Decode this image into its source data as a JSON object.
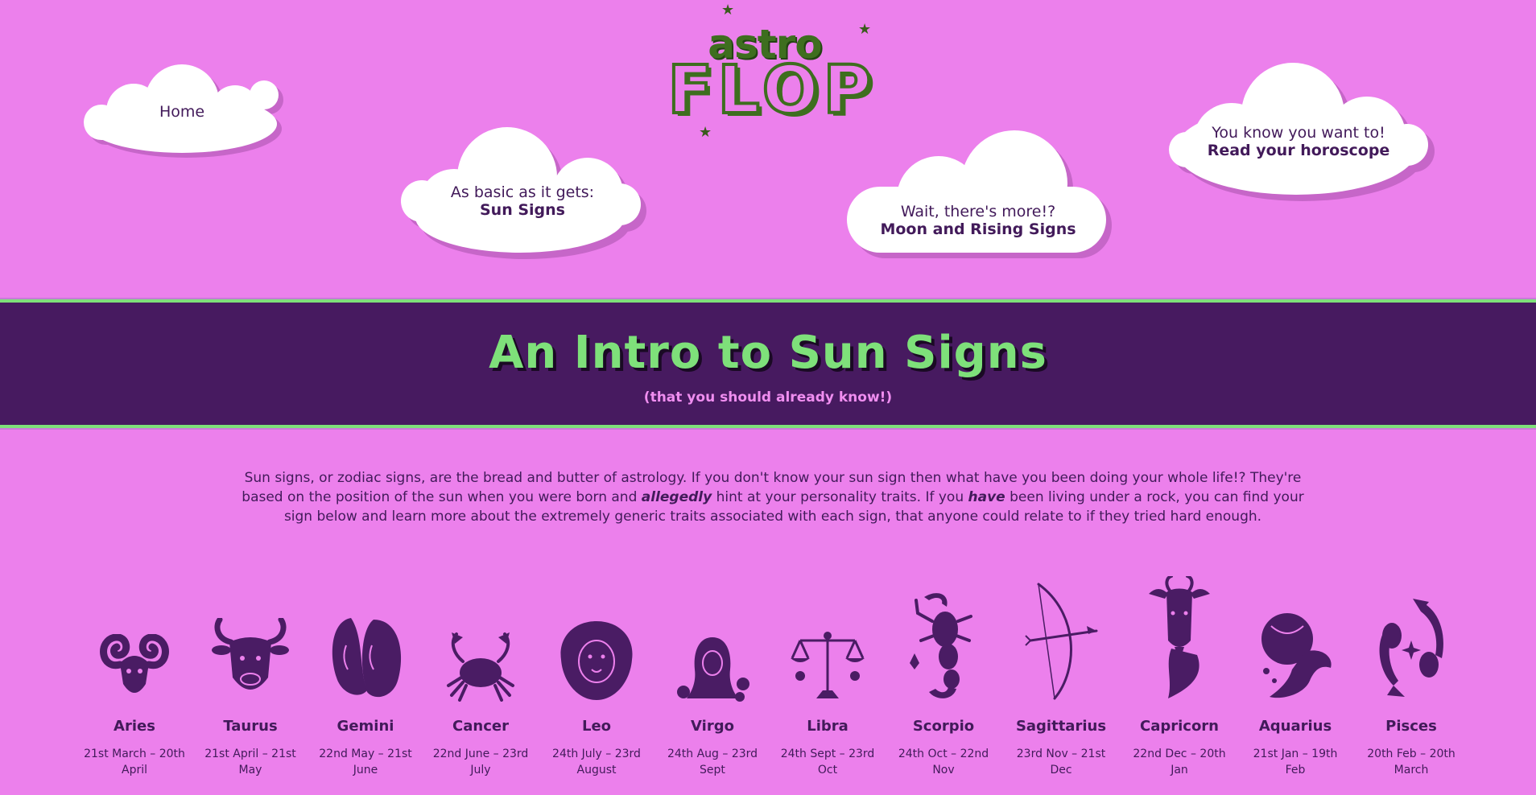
{
  "logo": {
    "top_text": "astro",
    "bottom_text": "FLOP"
  },
  "nav": {
    "home": {
      "line1": "Home"
    },
    "sun": {
      "line1": "As basic as it gets:",
      "line2": "Sun Signs"
    },
    "moon": {
      "line1": "Wait, there's more!?",
      "line2": "Moon and Rising Signs"
    },
    "horoscope": {
      "line1": "You know you want to!",
      "line2": "Read your horoscope"
    }
  },
  "banner": {
    "title": "An Intro to Sun Signs",
    "subtitle": "(that you should already know!)"
  },
  "intro": {
    "part1": "Sun signs, or zodiac signs, are the bread and butter of astrology. If you don't know your sun sign then what have you been doing your whole life!? They're based on the position of the sun when you were born and ",
    "emph1": "allegedly",
    "part2": " hint at your personality traits. If you ",
    "emph2": "have",
    "part3": " been living under a rock, you can find your sign below and learn more about the extremely generic traits associated with each sign, that anyone could relate to if they tried hard enough."
  },
  "colors": {
    "background": "#ec80ec",
    "banner": "#471a60",
    "accent_green": "#7ee07a",
    "text_purple": "#421a5a",
    "logo_green": "#3e6e1f"
  },
  "signs": [
    {
      "name": "Aries",
      "dates": "21st March – 20th April",
      "icon": "ram-icon"
    },
    {
      "name": "Taurus",
      "dates": "21st April – 21st May",
      "icon": "bull-icon"
    },
    {
      "name": "Gemini",
      "dates": "22nd May – 21st June",
      "icon": "twins-icon"
    },
    {
      "name": "Cancer",
      "dates": "22nd June – 23rd July",
      "icon": "crab-icon"
    },
    {
      "name": "Leo",
      "dates": "24th July – 23rd August",
      "icon": "lion-icon"
    },
    {
      "name": "Virgo",
      "dates": "24th Aug – 23rd Sept",
      "icon": "maiden-icon"
    },
    {
      "name": "Libra",
      "dates": "24th Sept – 23rd Oct",
      "icon": "scales-icon"
    },
    {
      "name": "Scorpio",
      "dates": "24th Oct – 22nd Nov",
      "icon": "scorpion-icon"
    },
    {
      "name": "Sagittarius",
      "dates": "23rd Nov – 21st Dec",
      "icon": "bow-arrow-icon"
    },
    {
      "name": "Capricorn",
      "dates": "22nd Dec – 20th Jan",
      "icon": "goat-icon"
    },
    {
      "name": "Aquarius",
      "dates": "21st Jan – 19th Feb",
      "icon": "water-bearer-icon"
    },
    {
      "name": "Pisces",
      "dates": "20th Feb – 20th March",
      "icon": "fish-icon"
    }
  ]
}
